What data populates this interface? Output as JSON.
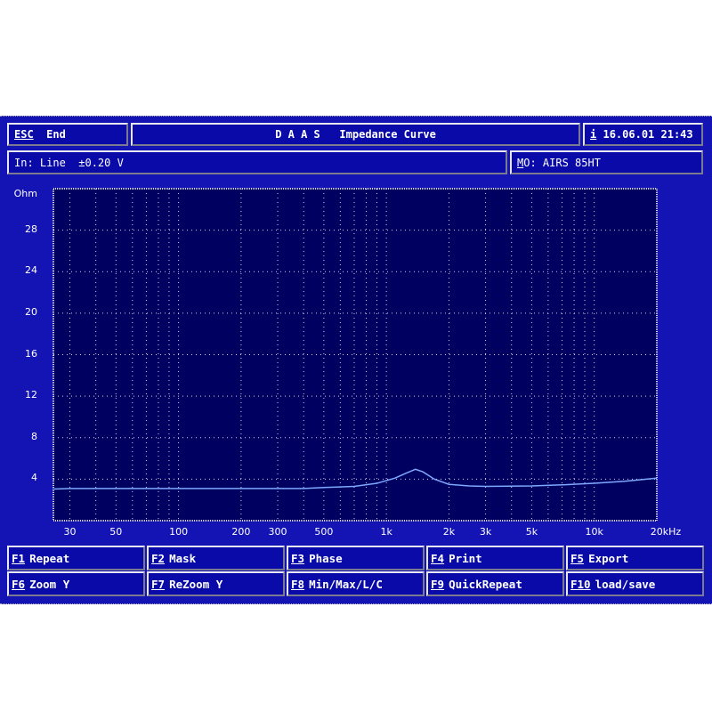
{
  "header": {
    "esc_key": "ESC",
    "esc_label": "End",
    "title": "D A A S   Impedance Curve",
    "info_key": "i",
    "datetime": "16.06.01 21:43"
  },
  "status": {
    "input": "In: Line  ±0.20 V",
    "model_key": "M",
    "model_label": "O: AIRS 85HT"
  },
  "colors": {
    "screen": "#1414b4",
    "plot_bg": "#000060",
    "curve": "#7fa8ff",
    "grid": "#d0d0e8"
  },
  "buttons": [
    {
      "key": "F1",
      "label": "Repeat"
    },
    {
      "key": "F2",
      "label": "Mask"
    },
    {
      "key": "F3",
      "label": "Phase"
    },
    {
      "key": "F4",
      "label": "Print"
    },
    {
      "key": "F5",
      "label": "Export"
    },
    {
      "key": "F6",
      "label": "Zoom Y"
    },
    {
      "key": "F7",
      "label": "ReZoom Y"
    },
    {
      "key": "F8",
      "label": "Min/Max/L/C"
    },
    {
      "key": "F9",
      "label": "QuickRepeat"
    },
    {
      "key": "F10",
      "label": "load/save"
    }
  ],
  "chart_data": {
    "type": "line",
    "title": "",
    "xlabel": "",
    "ylabel": "Ohm",
    "x_scale": "log",
    "xlim": [
      25,
      20000
    ],
    "ylim": [
      0,
      32
    ],
    "grid": true,
    "y_ticks": [
      "4",
      "8",
      "12",
      "16",
      "20",
      "24",
      "28"
    ],
    "x_ticks": [
      {
        "v": 30,
        "l": "30"
      },
      {
        "v": 50,
        "l": "50"
      },
      {
        "v": 100,
        "l": "100"
      },
      {
        "v": 200,
        "l": "200"
      },
      {
        "v": 300,
        "l": "300"
      },
      {
        "v": 500,
        "l": "500"
      },
      {
        "v": 1000,
        "l": "1k"
      },
      {
        "v": 2000,
        "l": "2k"
      },
      {
        "v": 3000,
        "l": "3k"
      },
      {
        "v": 5000,
        "l": "5k"
      },
      {
        "v": 10000,
        "l": "10k"
      },
      {
        "v": 20000,
        "l": "20kHz"
      }
    ],
    "series": [
      {
        "x": [
          25,
          30,
          50,
          100,
          200,
          400,
          500,
          700,
          900,
          1100,
          1250,
          1380,
          1500,
          1700,
          2000,
          2500,
          3000,
          5000,
          7000,
          10000,
          14000,
          20000
        ],
        "y": [
          3.05,
          3.1,
          3.1,
          3.1,
          3.1,
          3.1,
          3.2,
          3.3,
          3.6,
          4.1,
          4.6,
          4.95,
          4.7,
          4.0,
          3.5,
          3.35,
          3.3,
          3.35,
          3.45,
          3.6,
          3.8,
          4.1
        ]
      }
    ]
  }
}
